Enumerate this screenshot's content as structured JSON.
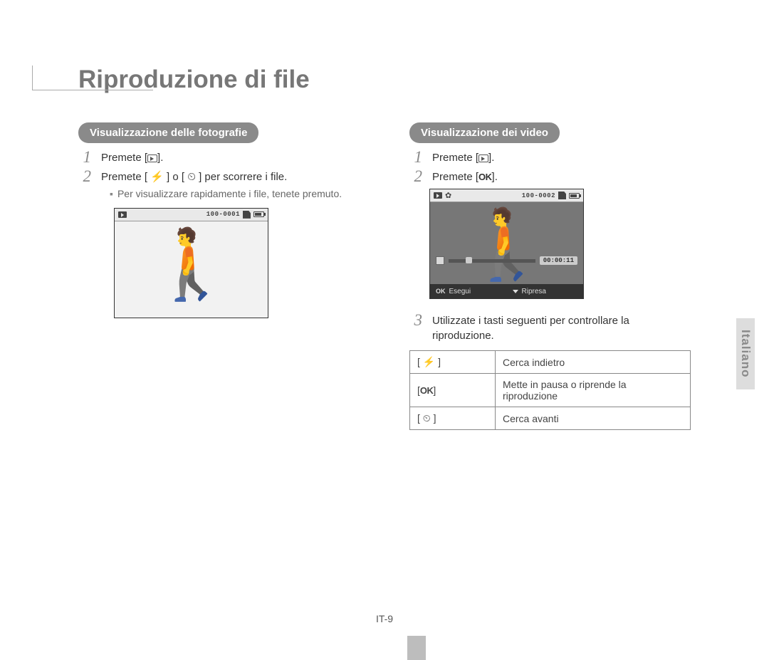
{
  "page": {
    "title": "Riproduzione di file",
    "number_label": "IT-9",
    "language_tab": "Italiano"
  },
  "left": {
    "heading": "Visualizzazione delle fotografie",
    "step1_prefix": "Premete [",
    "step1_suffix": "].",
    "step2": "Premete [ ⚡ ] o [ ⏲ ] per scorrere i file.",
    "bullet": "Per visualizzare rapidamente i file, tenete premuto.",
    "file_number": "100-0001"
  },
  "right": {
    "heading": "Visualizzazione dei video",
    "step1_prefix": "Premete [",
    "step1_suffix": "].",
    "step2_prefix": "Premete [",
    "step2_ok": "OK",
    "step2_suffix": "].",
    "file_number": "100-0002",
    "timecode": "00:00:11",
    "softkey_left": "Esegui",
    "softkey_right": "Ripresa",
    "step3": "Utilizzate i tasti seguenti per controllare la riproduzione.",
    "controls": {
      "flash_key": "[ ⚡ ]",
      "flash_desc": "Cerca indietro",
      "ok_key": "[OK]",
      "ok_desc": "Mette in pausa o riprende la riproduzione",
      "timer_key": "[ ⏲ ]",
      "timer_desc": "Cerca avanti"
    }
  }
}
